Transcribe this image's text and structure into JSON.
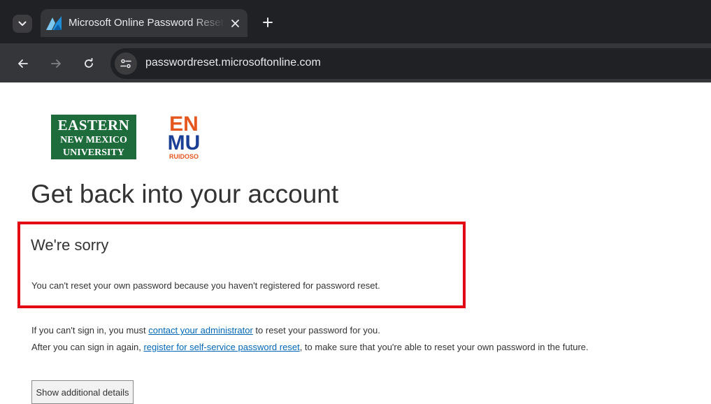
{
  "browser": {
    "tab_title": "Microsoft Online Password Reset",
    "url": "passwordreset.microsoftonline.com",
    "colors": {
      "frame": "#202124",
      "toolbar": "#35363a",
      "text": "#e8eaed"
    }
  },
  "logos": {
    "enmu": {
      "line1": "EASTERN",
      "line2": "NEW MEXICO",
      "line3": "UNIVERSITY",
      "color": "#1e6b3c"
    },
    "ruidoso": {
      "letters_top": "EN",
      "letters_bottom": "MU",
      "caption": "RUIDOSO",
      "orange": "#e5571f",
      "blue": "#1b3f94"
    }
  },
  "page": {
    "title": "Get back into your account",
    "error": {
      "heading": "We're sorry",
      "message": "You can't reset your own password because you haven't registered for password reset."
    },
    "help": {
      "line1_before": "If you can't sign in, you must ",
      "line1_link": "contact your administrator",
      "line1_after": " to reset your password for you.",
      "line2_before": "After you can sign in again, ",
      "line2_link": "register for self-service password reset",
      "line2_after": ", to make sure that you're able to reset your own password in the future."
    },
    "details_button": "Show additional details",
    "colors": {
      "link": "#0067b8",
      "highlight": "#e30613",
      "text": "#333333"
    }
  }
}
